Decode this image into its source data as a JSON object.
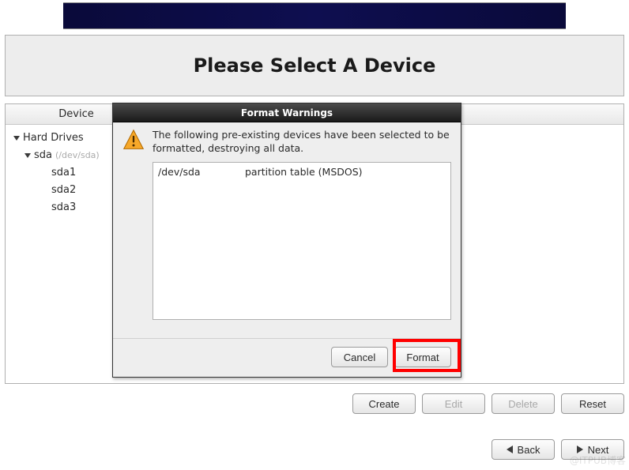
{
  "header_title": "Please Select A Device",
  "device_column_label": "Device",
  "tree": {
    "root_label": "Hard Drives",
    "disk_label": "sda",
    "disk_subtext": "(/dev/sda)",
    "partitions": [
      "sda1",
      "sda2",
      "sda3"
    ]
  },
  "buttons": {
    "create": "Create",
    "edit": "Edit",
    "delete": "Delete",
    "reset": "Reset",
    "back": "Back",
    "next": "Next"
  },
  "dialog": {
    "title": "Format Warnings",
    "message": "The following pre-existing devices have been selected to be formatted, destroying all data.",
    "items": [
      {
        "device": "/dev/sda",
        "desc": "partition table (MSDOS)"
      }
    ],
    "cancel": "Cancel",
    "format": "Format"
  },
  "watermark": "@ITPUB博客"
}
